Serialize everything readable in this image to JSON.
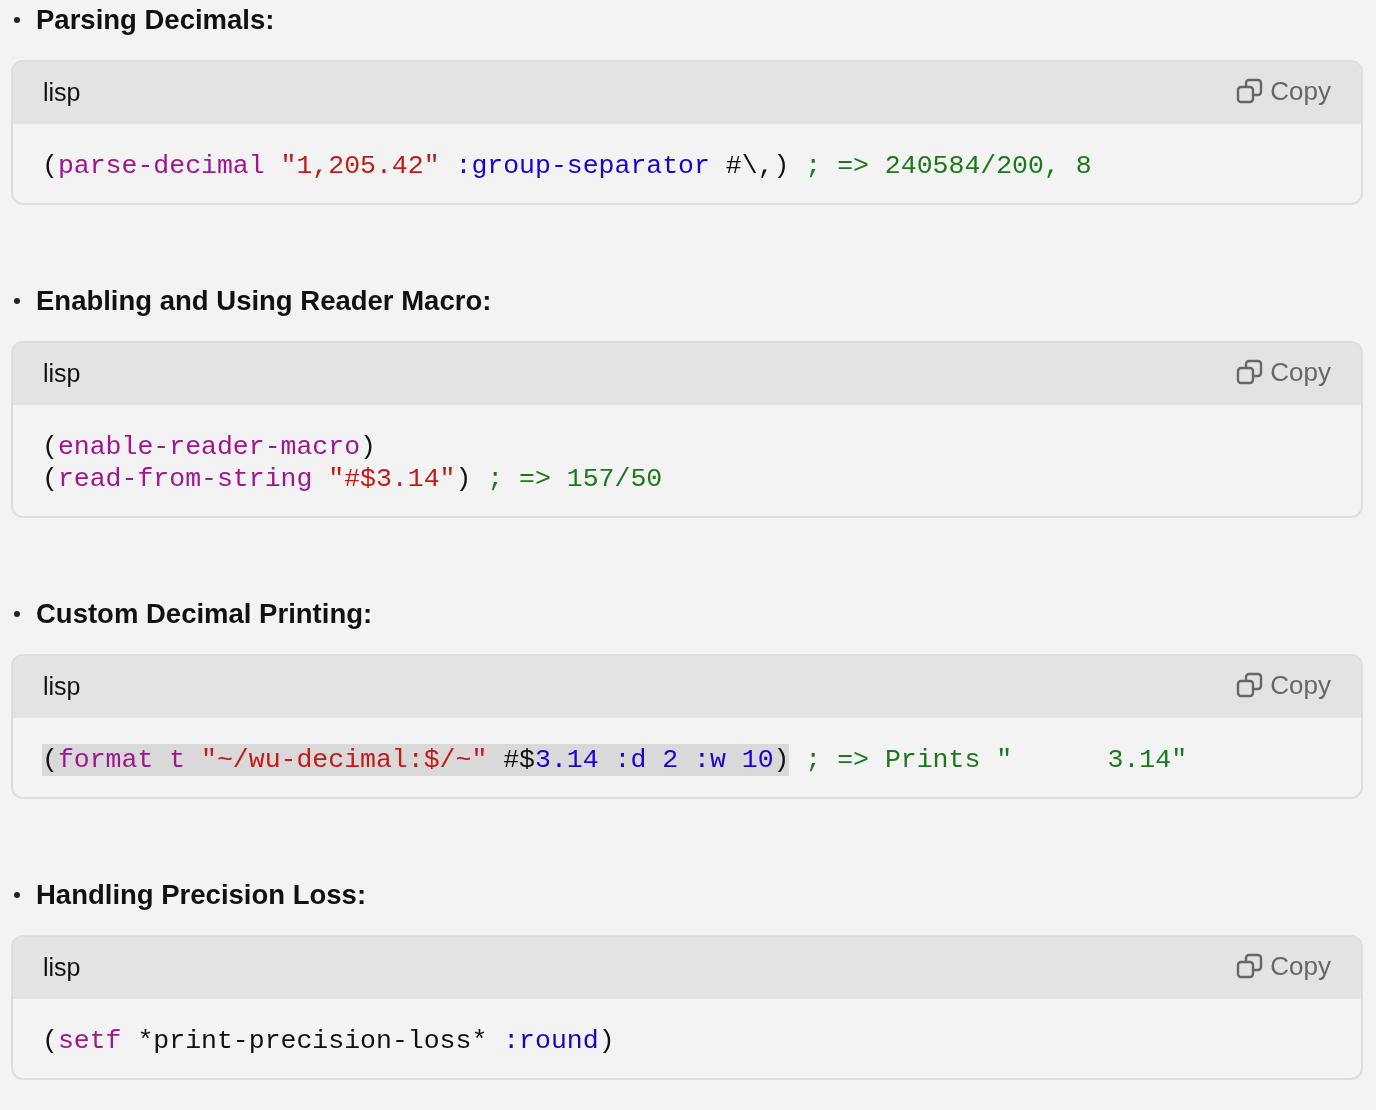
{
  "sections": [
    {
      "heading": "Parsing Decimals:",
      "code_block": {
        "language": "lisp",
        "copy_label": "Copy",
        "lines": [
          [
            {
              "highlighted": false,
              "tokens": [
                {
                  "kind": "plain",
                  "text": "("
                },
                {
                  "kind": "function",
                  "text": "parse-decimal"
                },
                {
                  "kind": "string",
                  "text": " \"1,205.42\""
                },
                {
                  "kind": "keyword",
                  "text": " :group-separator"
                },
                {
                  "kind": "plain",
                  "text": " #\\,)"
                },
                {
                  "kind": "comment",
                  "text": " ; => 240584/200, 8"
                }
              ]
            }
          ]
        ]
      }
    },
    {
      "heading": "Enabling and Using Reader Macro:",
      "code_block": {
        "language": "lisp",
        "copy_label": "Copy",
        "lines": [
          [
            {
              "highlighted": false,
              "tokens": [
                {
                  "kind": "plain",
                  "text": "("
                },
                {
                  "kind": "function",
                  "text": "enable-reader-macro"
                },
                {
                  "kind": "plain",
                  "text": ")"
                }
              ]
            }
          ],
          [
            {
              "highlighted": false,
              "tokens": [
                {
                  "kind": "plain",
                  "text": "("
                },
                {
                  "kind": "function",
                  "text": "read-from-string"
                },
                {
                  "kind": "string",
                  "text": " \"#$3.14\""
                },
                {
                  "kind": "plain",
                  "text": ")"
                },
                {
                  "kind": "comment",
                  "text": " ; => 157/50"
                }
              ]
            }
          ]
        ]
      }
    },
    {
      "heading": "Custom Decimal Printing:",
      "code_block": {
        "language": "lisp",
        "copy_label": "Copy",
        "lines": [
          [
            {
              "highlighted": true,
              "tokens": [
                {
                  "kind": "plain",
                  "text": "("
                },
                {
                  "kind": "function",
                  "text": "format t"
                },
                {
                  "kind": "string",
                  "text": " \"~/wu-decimal:$/~\""
                },
                {
                  "kind": "plain",
                  "text": " #$"
                },
                {
                  "kind": "keyword",
                  "text": "3.14 :d 2 :w 10"
                },
                {
                  "kind": "plain",
                  "text": ")"
                }
              ]
            },
            {
              "highlighted": false,
              "tokens": [
                {
                  "kind": "comment",
                  "text": " ; => Prints \"      3.14\""
                }
              ]
            }
          ]
        ]
      }
    },
    {
      "heading": "Handling Precision Loss:",
      "code_block": {
        "language": "lisp",
        "copy_label": "Copy",
        "lines": [
          [
            {
              "highlighted": false,
              "tokens": [
                {
                  "kind": "plain",
                  "text": "("
                },
                {
                  "kind": "function",
                  "text": "setf"
                },
                {
                  "kind": "plain",
                  "text": " *print-precision-loss*"
                },
                {
                  "kind": "keyword",
                  "text": " :round"
                },
                {
                  "kind": "plain",
                  "text": ")"
                }
              ]
            }
          ]
        ]
      }
    }
  ]
}
